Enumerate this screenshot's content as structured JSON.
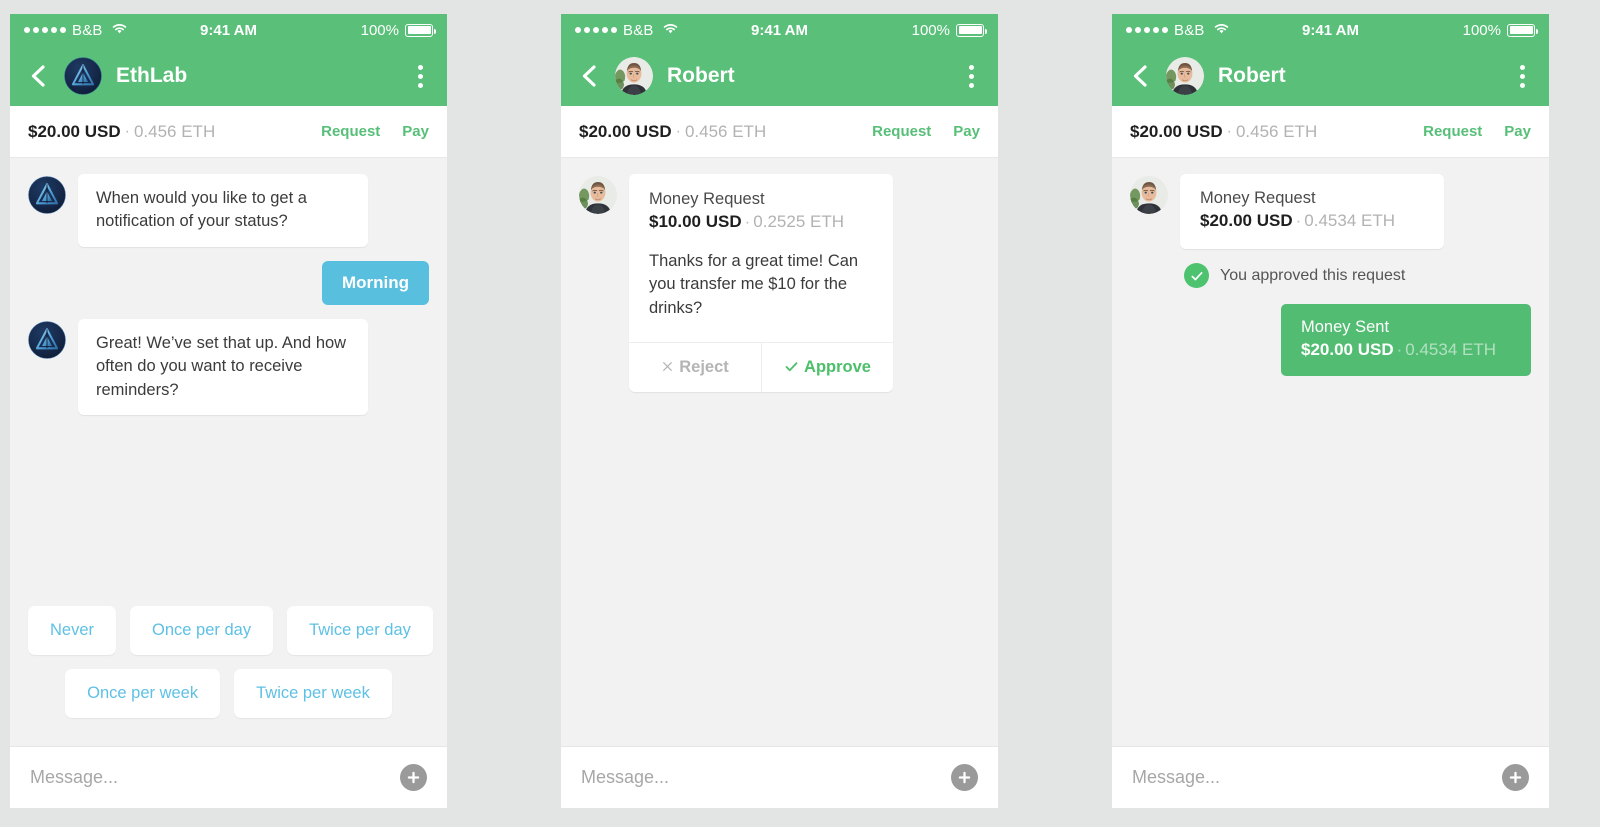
{
  "colors": {
    "header_green": "#59bf79",
    "accent_green": "#58bf79",
    "bubble_blue": "#58bfdf",
    "chip_blue": "#5ec0e4",
    "page_bg": "#e3e5e4",
    "chat_bg": "#f2f2f2"
  },
  "status_bar": {
    "carrier": "B&B",
    "wifi_icon": "wifi-icon",
    "time": "9:41 AM",
    "battery_percent": "100%",
    "battery_icon": "battery-full-icon",
    "signal_dots": 5
  },
  "panels": [
    {
      "id": "panel-ethlab",
      "nav": {
        "back_icon": "back-chevron-icon",
        "avatar_name": "ethlab-logo-avatar",
        "title": "EthLab",
        "menu_icon": "kebab-menu-icon"
      },
      "balance": {
        "usd": "$20.00 USD",
        "separator": "·",
        "eth": "0.456 ETH",
        "request_label": "Request",
        "pay_label": "Pay"
      },
      "messages": [
        {
          "type": "incoming",
          "avatar_name": "ethlab-logo-avatar",
          "text": "When would you like to get a notification of your status?"
        },
        {
          "type": "outgoing",
          "text": "Morning"
        },
        {
          "type": "incoming",
          "avatar_name": "ethlab-logo-avatar",
          "text": "Great! We’ve set that up. And how often do you want to receive reminders?"
        }
      ],
      "quick_replies": {
        "row1": [
          "Never",
          "Once per day",
          "Twice per day"
        ],
        "row2": [
          "Once per week",
          "Twice per week"
        ]
      },
      "composer": {
        "placeholder": "Message...",
        "value": "",
        "attach_icon": "plus-circle-icon"
      }
    },
    {
      "id": "panel-request",
      "nav": {
        "back_icon": "back-chevron-icon",
        "avatar_name": "robert-photo-avatar",
        "title": "Robert",
        "menu_icon": "kebab-menu-icon"
      },
      "balance": {
        "usd": "$20.00 USD",
        "separator": "·",
        "eth": "0.456 ETH",
        "request_label": "Request",
        "pay_label": "Pay"
      },
      "money_request": {
        "avatar_name": "robert-photo-avatar",
        "title": "Money Request",
        "amount_usd": "$10.00 USD",
        "separator": "·",
        "amount_eth": "0.2525 ETH",
        "note": "Thanks for a great time! Can you transfer me $10 for the drinks?",
        "reject_label": "Reject",
        "reject_icon": "close-x-icon",
        "approve_label": "Approve",
        "approve_icon": "checkmark-icon"
      },
      "composer": {
        "placeholder": "Message...",
        "value": "",
        "attach_icon": "plus-circle-icon"
      }
    },
    {
      "id": "panel-approved",
      "nav": {
        "back_icon": "back-chevron-icon",
        "avatar_name": "robert-photo-avatar",
        "title": "Robert",
        "menu_icon": "kebab-menu-icon"
      },
      "balance": {
        "usd": "$20.00 USD",
        "separator": "·",
        "eth": "0.456 ETH",
        "request_label": "Request",
        "pay_label": "Pay"
      },
      "money_request": {
        "avatar_name": "robert-photo-avatar",
        "title": "Money Request",
        "amount_usd": "$20.00 USD",
        "separator": "·",
        "amount_eth": "0.4534 ETH"
      },
      "approved_status": {
        "icon": "check-circle-icon",
        "text": "You approved this request"
      },
      "money_sent": {
        "title": "Money Sent",
        "amount_usd": "$20.00 USD",
        "separator": "·",
        "amount_eth": "0.4534 ETH"
      },
      "composer": {
        "placeholder": "Message...",
        "value": "",
        "attach_icon": "plus-circle-icon"
      }
    }
  ]
}
